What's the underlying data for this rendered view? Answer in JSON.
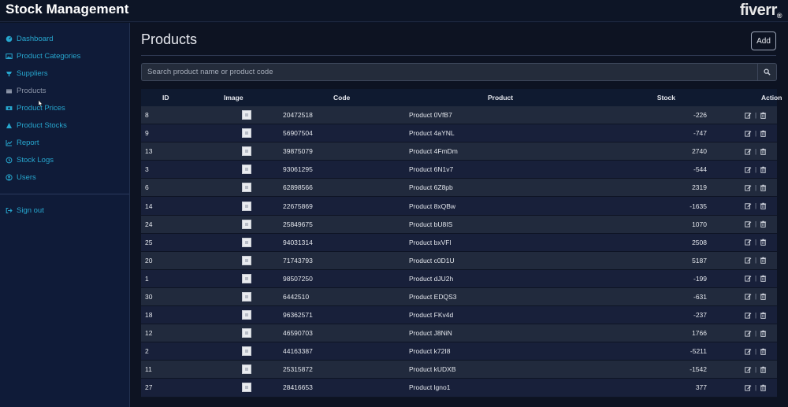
{
  "header": {
    "app_title": "Stock Management",
    "brand": "fiverr",
    "brand_mark": "®"
  },
  "sidebar": {
    "items": [
      {
        "label": "Dashboard",
        "icon": "dashboard-icon"
      },
      {
        "label": "Product Categories",
        "icon": "image-icon"
      },
      {
        "label": "Suppliers",
        "icon": "supplier-icon"
      },
      {
        "label": "Products",
        "icon": "box-icon"
      },
      {
        "label": "Product Prices",
        "icon": "money-icon"
      },
      {
        "label": "Product Stocks",
        "icon": "stock-icon"
      },
      {
        "label": "Report",
        "icon": "chart-icon"
      },
      {
        "label": "Stock Logs",
        "icon": "history-icon"
      },
      {
        "label": "Users",
        "icon": "user-icon"
      }
    ],
    "signout": {
      "label": "Sign out",
      "icon": "sign-out-icon"
    }
  },
  "main": {
    "title": "Products",
    "add_label": "Add",
    "search": {
      "placeholder": "Search product name or product code",
      "value": ""
    },
    "table": {
      "columns": [
        "ID",
        "Image",
        "Code",
        "Product",
        "Stock",
        "Action"
      ],
      "rows": [
        {
          "id": "8",
          "code": "20472518",
          "product": "Product 0VfB7",
          "stock": "-226"
        },
        {
          "id": "9",
          "code": "56907504",
          "product": "Product 4aYNL",
          "stock": "-747"
        },
        {
          "id": "13",
          "code": "39875079",
          "product": "Product 4FmDm",
          "stock": "2740"
        },
        {
          "id": "3",
          "code": "93061295",
          "product": "Product 6N1v7",
          "stock": "-544"
        },
        {
          "id": "6",
          "code": "62898566",
          "product": "Product 6Z8pb",
          "stock": "2319"
        },
        {
          "id": "14",
          "code": "22675869",
          "product": "Product 8xQBw",
          "stock": "-1635"
        },
        {
          "id": "24",
          "code": "25849675",
          "product": "Product bU8IS",
          "stock": "1070"
        },
        {
          "id": "25",
          "code": "94031314",
          "product": "Product bxVFl",
          "stock": "2508"
        },
        {
          "id": "20",
          "code": "71743793",
          "product": "Product c0D1U",
          "stock": "5187"
        },
        {
          "id": "1",
          "code": "98507250",
          "product": "Product dJU2h",
          "stock": "-199"
        },
        {
          "id": "30",
          "code": "6442510",
          "product": "Product EDQS3",
          "stock": "-631"
        },
        {
          "id": "18",
          "code": "96362571",
          "product": "Product FKv4d",
          "stock": "-237"
        },
        {
          "id": "12",
          "code": "46590703",
          "product": "Product J8NiN",
          "stock": "1766"
        },
        {
          "id": "2",
          "code": "44163387",
          "product": "Product k72I8",
          "stock": "-5211"
        },
        {
          "id": "11",
          "code": "25315872",
          "product": "Product kUDXB",
          "stock": "-1542"
        },
        {
          "id": "27",
          "code": "28416653",
          "product": "Product lgno1",
          "stock": "377"
        }
      ]
    }
  },
  "colors": {
    "accent": "#27a7cf",
    "sidebar_bg": "#0f1b38",
    "main_bg": "#0d1322",
    "row_odd": "#212a3d",
    "row_even": "#18203a"
  }
}
